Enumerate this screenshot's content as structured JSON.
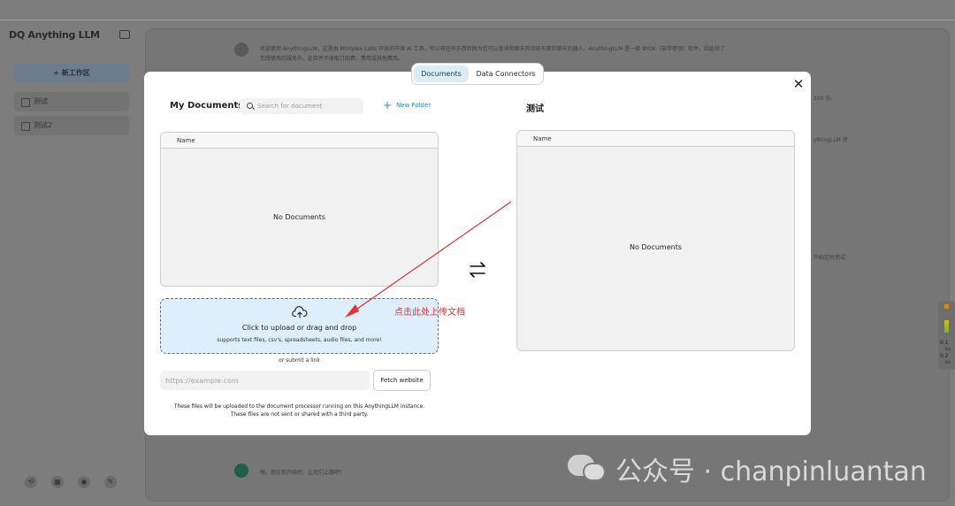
{
  "background": {
    "app_logo": "DQ Anything LLM",
    "new_workspace_label": "+ 新工作区",
    "workspaces": [
      "测试",
      "测试2"
    ],
    "chat_intro_line1": "欢迎使用 AnythingLLM，这是由 Mintplex Labs 开发的开源 AI 工具，可以将任何东西转换为您可以查询和聊天的训练有素的聊天机器人。AnythingLLM 是一款 BYOK（自带密钥）软件，因此除了",
    "chat_intro_line2": "您想使用的服务外，此软件不收取订阅费、费用或其他费用。",
    "chat_bottom_msg": "嗨，现在就开始吧，让我们上路吧！",
    "side_snippets": [
      "100 份。",
      "ythingLLM 使",
      "开始定时测试"
    ],
    "sysmon_values": [
      "0.1",
      "0.2"
    ],
    "sysmon_unit": "K/s"
  },
  "modal": {
    "tabs": [
      {
        "label": "Documents",
        "active": true
      },
      {
        "label": "Data Connectors",
        "active": false
      }
    ],
    "close_icon": "✕",
    "my_documents": {
      "title": "My Documents",
      "search_placeholder": "Search for document",
      "new_folder_label": "New Folder",
      "column_header": "Name",
      "empty_text": "No Documents"
    },
    "upload": {
      "main_text": "Click to upload or drag and drop",
      "sub_text": "supports text files, csv's, spreadsheets, audio files, and more!",
      "or_text": "or submit a link",
      "url_placeholder": "https://example.com",
      "fetch_label": "Fetch website",
      "notice_line1": "These files will be uploaded to the document processor running on this AnythingLLM instance.",
      "notice_line2": "These files are not sent or shared with a third party."
    },
    "workspace_docs": {
      "title": "测试",
      "column_header": "Name",
      "empty_text": "No Documents"
    }
  },
  "annotation": {
    "text": "点击此处上传文档",
    "color": "#e53232"
  },
  "watermark": {
    "text": "公众号 · chanpinluantan"
  }
}
